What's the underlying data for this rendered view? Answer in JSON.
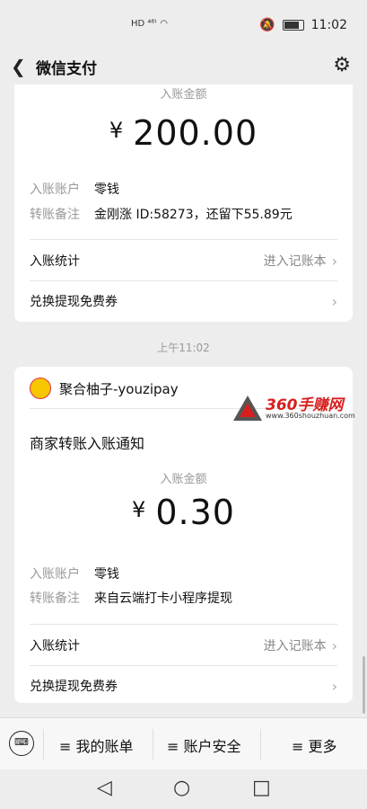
{
  "status": {
    "left": "HD ⁴⁶ᴵ",
    "time": "11:02"
  },
  "header": {
    "title": "微信支付"
  },
  "card1": {
    "amount_label": "入账金额",
    "currency": "¥",
    "amount": "200.00",
    "account_key": "入账账户",
    "account_value": "零钱",
    "note_key": "转账备注",
    "note_value": "金刚涨 ID:58273，还留下55.89元",
    "stats_label": "入账统计",
    "stats_action": "进入记账本",
    "coupon_label": "兑换提现免费券"
  },
  "timestamp": "上午11:02",
  "card2": {
    "merchant_name": "聚合柚子-youzipay",
    "notice_title": "商家转账入账通知",
    "amount_label": "入账金额",
    "currency": "¥",
    "amount": "0.30",
    "account_key": "入账账户",
    "account_value": "零钱",
    "note_key": "转账备注",
    "note_value": "来自云端打卡小程序提现",
    "stats_label": "入账统计",
    "stats_action": "进入记账本",
    "coupon_label": "兑换提现免费券"
  },
  "watermark": {
    "brand": "360手赚网",
    "url": "www.360shouzhuan.com"
  },
  "bottom_menu": {
    "item1": "≡ 我的账单",
    "item2": "≡ 账户安全",
    "item3": "≡ 更多"
  },
  "colors": {
    "accent": "#d81e1e",
    "bg": "#ededed"
  }
}
